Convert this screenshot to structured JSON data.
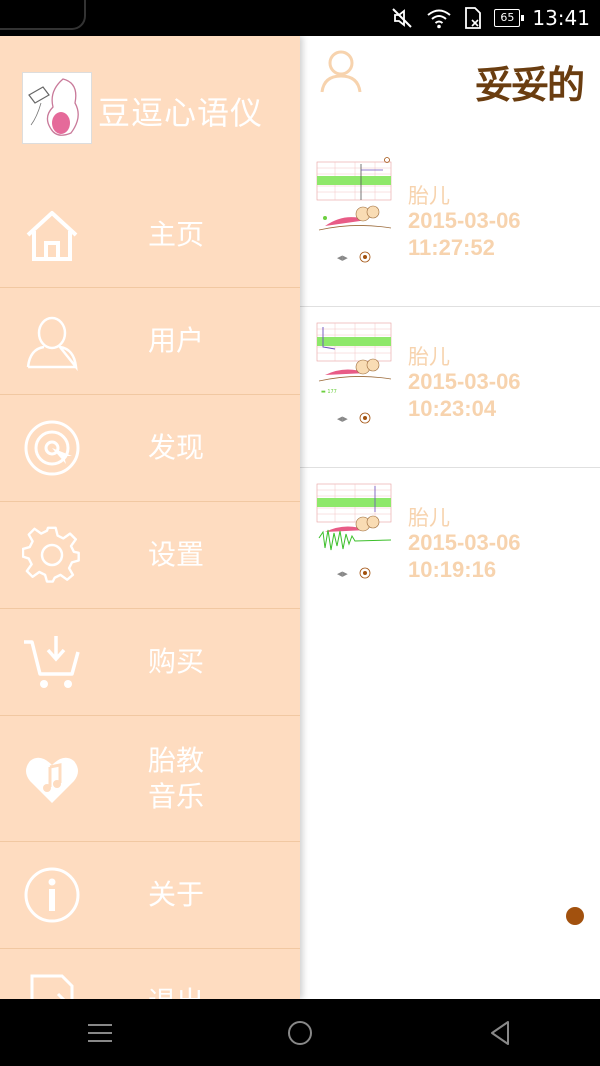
{
  "status_bar": {
    "battery_level": "65",
    "time": "13:41",
    "icons": [
      "mute-icon",
      "wifi-icon",
      "sim-card-icon",
      "battery-icon"
    ]
  },
  "app": {
    "name": "豆逗心语仪",
    "drawer_bg": "#fedcc0",
    "accent": "#a2510e"
  },
  "menu": {
    "items": [
      {
        "icon": "home-icon",
        "label": "主页"
      },
      {
        "icon": "user-icon",
        "label": "用户"
      },
      {
        "icon": "discover-icon",
        "label": "发现"
      },
      {
        "icon": "settings-icon",
        "label": "设置"
      },
      {
        "icon": "cart-icon",
        "label": "购买"
      },
      {
        "icon": "music-heart-icon",
        "label": "胎教音乐"
      },
      {
        "icon": "info-icon",
        "label": "关于"
      },
      {
        "icon": "logout-icon",
        "label": "退出"
      }
    ]
  },
  "content": {
    "header_title": "妥妥的",
    "records": [
      {
        "name": "胎儿",
        "date": "2015-03-06",
        "time": "11:27:52"
      },
      {
        "name": "胎儿",
        "date": "2015-03-06",
        "time": "10:23:04"
      },
      {
        "name": "胎儿",
        "date": "2015-03-06",
        "time": "10:19:16"
      }
    ]
  },
  "nav_bar": {
    "buttons": [
      "menu-icon",
      "home-circle-icon",
      "back-triangle-icon"
    ]
  }
}
